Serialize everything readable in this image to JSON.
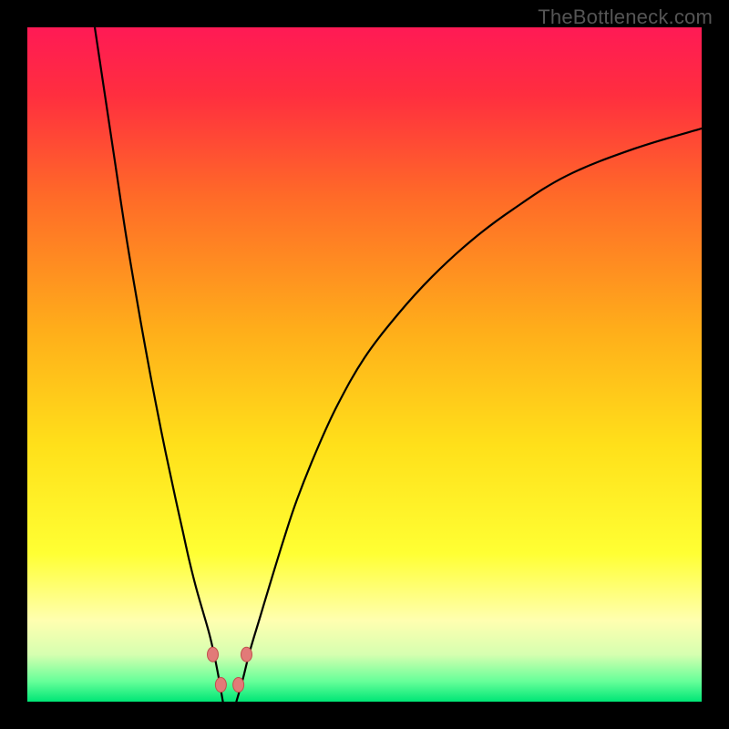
{
  "watermark": "TheBottleneck.com",
  "chart_data": {
    "type": "line",
    "title": "",
    "xlabel": "",
    "ylabel": "",
    "xlim": [
      0,
      100
    ],
    "ylim": [
      0,
      100
    ],
    "background_gradient": {
      "stops": [
        {
          "offset": 0.0,
          "color": "#ff1a55"
        },
        {
          "offset": 0.1,
          "color": "#ff2e3f"
        },
        {
          "offset": 0.25,
          "color": "#ff6a28"
        },
        {
          "offset": 0.45,
          "color": "#ffae1a"
        },
        {
          "offset": 0.62,
          "color": "#ffe01a"
        },
        {
          "offset": 0.78,
          "color": "#ffff33"
        },
        {
          "offset": 0.88,
          "color": "#ffffb0"
        },
        {
          "offset": 0.93,
          "color": "#d6ffb0"
        },
        {
          "offset": 0.97,
          "color": "#66ff99"
        },
        {
          "offset": 1.0,
          "color": "#00e676"
        }
      ]
    },
    "series": [
      {
        "name": "left-branch",
        "x": [
          10.0,
          11.5,
          13.0,
          14.5,
          16.0,
          17.5,
          19.0,
          20.5,
          22.0,
          23.0,
          24.0,
          25.0,
          26.0,
          27.0,
          27.7,
          28.3,
          29.0
        ],
        "y": [
          100.0,
          90.0,
          80.0,
          70.0,
          61.0,
          52.5,
          44.5,
          37.0,
          30.0,
          25.5,
          21.0,
          17.0,
          13.5,
          10.0,
          7.0,
          4.0,
          0.0
        ]
      },
      {
        "name": "right-branch",
        "x": [
          31.0,
          32.0,
          33.0,
          34.5,
          36.0,
          38.0,
          40.0,
          43.0,
          46.0,
          50.0,
          55.0,
          60.0,
          66.0,
          72.0,
          80.0,
          90.0,
          100.0
        ],
        "y": [
          0.0,
          3.5,
          7.5,
          12.5,
          17.5,
          24.0,
          30.0,
          37.5,
          44.0,
          51.0,
          57.5,
          63.0,
          68.5,
          73.0,
          78.0,
          82.0,
          85.0
        ]
      }
    ],
    "markers": [
      {
        "x": 27.5,
        "y": 7.0
      },
      {
        "x": 32.5,
        "y": 7.0
      },
      {
        "x": 28.7,
        "y": 2.5
      },
      {
        "x": 31.3,
        "y": 2.5
      }
    ],
    "marker_style": {
      "rx": 6,
      "ry": 8,
      "fill": "#e27a78",
      "stroke": "#c24f4d"
    },
    "curve_style": {
      "stroke": "#000000",
      "width": 2.2
    }
  }
}
